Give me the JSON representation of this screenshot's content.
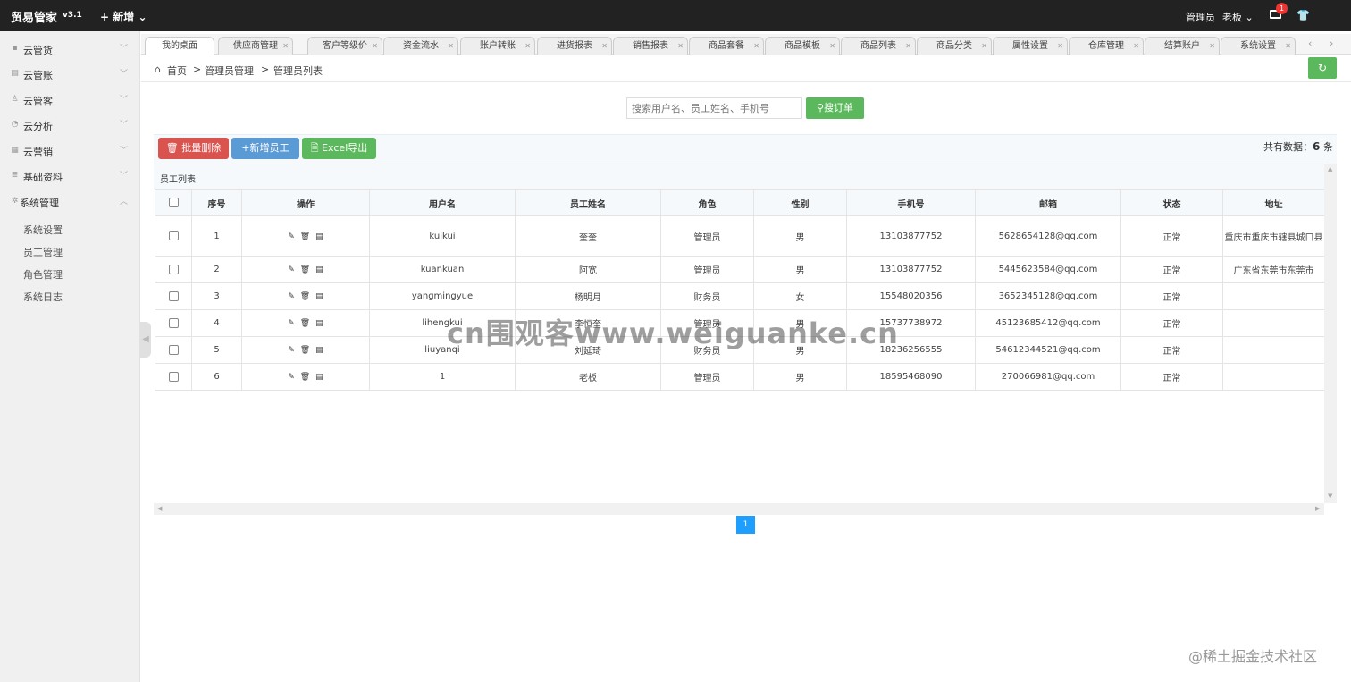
{
  "topbar": {
    "app_name": "贸易管家",
    "version": "v3.1",
    "new_label": "新增",
    "role": "管理员",
    "user": "老板",
    "mail_count": "1"
  },
  "sidebar": {
    "items": [
      {
        "label": "云管货",
        "icon": "truck-icon"
      },
      {
        "label": "云管账",
        "icon": "ledger-icon"
      },
      {
        "label": "云管客",
        "icon": "user-icon"
      },
      {
        "label": "云分析",
        "icon": "chart-icon"
      },
      {
        "label": "云营销",
        "icon": "shop-icon"
      },
      {
        "label": "基础资料",
        "icon": "database-icon"
      },
      {
        "label": "系统管理",
        "icon": "gear-icon"
      }
    ],
    "subitems": [
      "系统设置",
      "员工管理",
      "角色管理",
      "系统日志"
    ]
  },
  "tabs": [
    "我的桌面",
    "供应商管理",
    "客户等级价",
    "资金流水",
    "账户转账",
    "进货报表",
    "销售报表",
    "商品套餐",
    "商品模板",
    "商品列表",
    "商品分类",
    "属性设置",
    "仓库管理",
    "结算账户",
    "系统设置"
  ],
  "breadcrumb": {
    "home": "首页",
    "level1": "管理员管理",
    "level2": "管理员列表",
    "sep": ">"
  },
  "search": {
    "placeholder": "搜索用户名、员工姓名、手机号",
    "button": "搜订单"
  },
  "toolbar": {
    "batch_delete": "批量删除",
    "add_staff": "新增员工",
    "excel_export": "Excel导出",
    "total_prefix": "共有数据：",
    "total_count": "6",
    "total_suffix": "条"
  },
  "panel_title": "员工列表",
  "table": {
    "headers": [
      "序号",
      "操作",
      "用户名",
      "员工姓名",
      "角色",
      "性别",
      "手机号",
      "邮箱",
      "状态",
      "地址"
    ],
    "rows": [
      {
        "no": "1",
        "username": "kuikui",
        "name": "奎奎",
        "role": "管理员",
        "gender": "男",
        "phone": "13103877752",
        "email": "5628654128@qq.com",
        "status": "正常",
        "address": "重庆市重庆市辖县城口县"
      },
      {
        "no": "2",
        "username": "kuankuan",
        "name": "阿宽",
        "role": "管理员",
        "gender": "男",
        "phone": "13103877752",
        "email": "5445623584@qq.com",
        "status": "正常",
        "address": "广东省东莞市东莞市"
      },
      {
        "no": "3",
        "username": "yangmingyue",
        "name": "杨明月",
        "role": "财务员",
        "gender": "女",
        "phone": "15548020356",
        "email": "3652345128@qq.com",
        "status": "正常",
        "address": ""
      },
      {
        "no": "4",
        "username": "lihengkui",
        "name": "李恒奎",
        "role": "管理员",
        "gender": "男",
        "phone": "15737738972",
        "email": "45123685412@qq.com",
        "status": "正常",
        "address": ""
      },
      {
        "no": "5",
        "username": "liuyanqi",
        "name": "刘延琦",
        "role": "财务员",
        "gender": "男",
        "phone": "18236256555",
        "email": "54612344521@qq.com",
        "status": "正常",
        "address": ""
      },
      {
        "no": "6",
        "username": "1",
        "name": "老板",
        "role": "管理员",
        "gender": "男",
        "phone": "18595468090",
        "email": "270066981@qq.com",
        "status": "正常",
        "address": ""
      }
    ]
  },
  "pagination": {
    "current": "1"
  },
  "watermarks": {
    "center": "cn围观客www.weiguanke.cn",
    "corner": "@稀土掘金技术社区"
  }
}
